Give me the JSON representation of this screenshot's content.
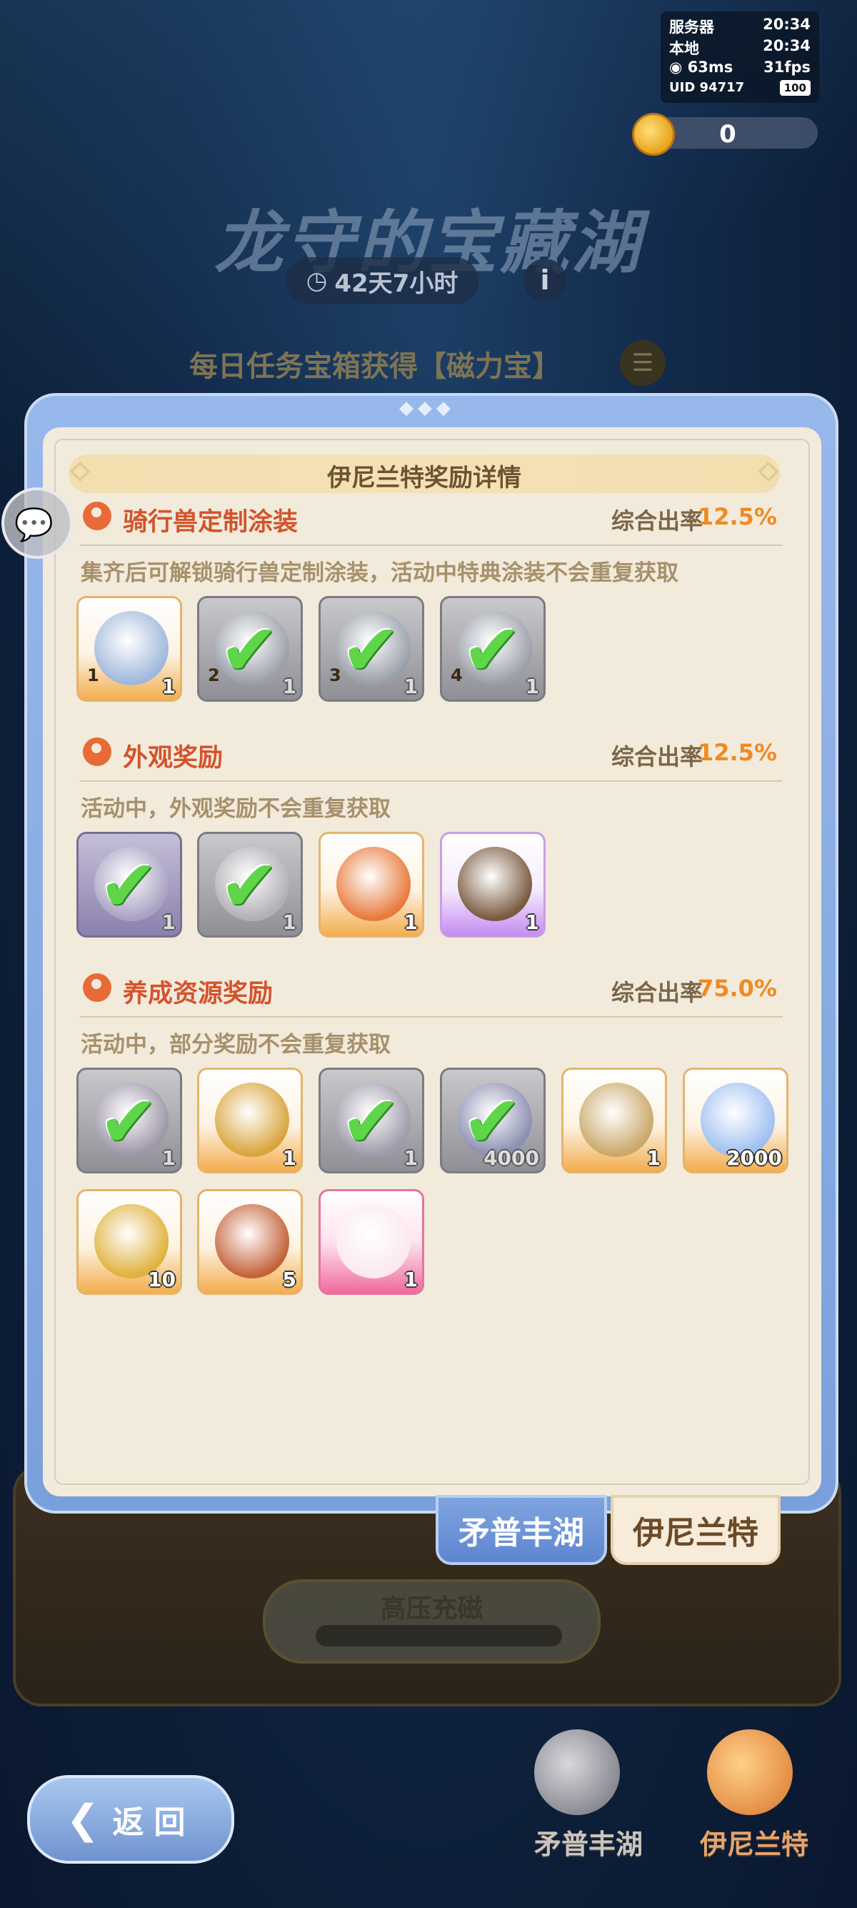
{
  "status": {
    "server_label": "服务器",
    "server_time": "20:34",
    "local_label": "本地",
    "local_time": "20:34",
    "ping": "63ms",
    "fps": "31fps",
    "uid_label": "UID",
    "uid": "94717",
    "battery": "100"
  },
  "currency": {
    "icon": "magnet-coin-icon",
    "value": "0"
  },
  "event": {
    "title": "龙守的宝藏湖",
    "timer": "42天7小时",
    "daily_text": "每日任务宝箱获得【磁力宝】"
  },
  "modal": {
    "title": "伊尼兰特奖励详情",
    "sections": [
      {
        "title": "骑行兽定制涂装",
        "rate_label": "综合出率",
        "rate": "12.5%",
        "desc": "集齐后可解锁骑行兽定制涂装，活动中特典涂装不会重复获取",
        "items": [
          {
            "style": "orange",
            "qty": "1",
            "badge": "1",
            "claimed": false,
            "art_color": "#9fb8dc"
          },
          {
            "style": "grey",
            "qty": "1",
            "badge": "2",
            "claimed": true,
            "art_color": "#9aa0aa"
          },
          {
            "style": "grey",
            "qty": "1",
            "badge": "3",
            "claimed": true,
            "art_color": "#9aa0aa"
          },
          {
            "style": "grey",
            "qty": "1",
            "badge": "4",
            "claimed": true,
            "art_color": "#9aa0aa"
          }
        ]
      },
      {
        "title": "外观奖励",
        "rate_label": "综合出率",
        "rate": "12.5%",
        "desc": "活动中，外观奖励不会重复获取",
        "items": [
          {
            "style": "greypurple",
            "qty": "1",
            "badge": "",
            "claimed": true,
            "art_color": "#a9a2c2"
          },
          {
            "style": "grey",
            "qty": "1",
            "badge": "",
            "claimed": true,
            "art_color": "#b0b0b6"
          },
          {
            "style": "orange",
            "qty": "1",
            "badge": "",
            "claimed": false,
            "art_color": "#e87a3c"
          },
          {
            "style": "purple",
            "qty": "1",
            "badge": "",
            "claimed": false,
            "art_color": "#7a5a40"
          }
        ]
      },
      {
        "title": "养成资源奖励",
        "rate_label": "综合出率",
        "rate": "75.0%",
        "desc": "活动中，部分奖励不会重复获取",
        "items": [
          {
            "style": "grey",
            "qty": "1",
            "badge": "",
            "claimed": true,
            "art_color": "#9d96a8"
          },
          {
            "style": "orange",
            "qty": "1",
            "badge": "",
            "claimed": false,
            "art_color": "#d9a43c"
          },
          {
            "style": "grey",
            "qty": "1",
            "badge": "",
            "claimed": true,
            "art_color": "#a09cab"
          },
          {
            "style": "grey",
            "qty": "4000",
            "badge": "",
            "claimed": true,
            "art_color": "#8b8fb0"
          },
          {
            "style": "orange",
            "qty": "1",
            "badge": "",
            "claimed": false,
            "art_color": "#c9a86a"
          },
          {
            "style": "orange",
            "qty": "2000",
            "badge": "",
            "claimed": false,
            "art_color": "#9fc0f2"
          },
          {
            "style": "orange",
            "qty": "10",
            "badge": "",
            "claimed": false,
            "art_color": "#e0b23c"
          },
          {
            "style": "orange",
            "qty": "5",
            "badge": "",
            "claimed": false,
            "art_color": "#c4623a"
          },
          {
            "style": "pink",
            "qty": "1",
            "badge": "",
            "claimed": false,
            "art_color": "#fbe9ee"
          }
        ]
      }
    ],
    "tabs": [
      "矛普丰湖",
      "伊尼兰特"
    ],
    "active_tab": "伊尼兰特"
  },
  "bottom": {
    "charge_label": "高压充磁",
    "back_label": "返回",
    "lake_left": "矛普丰湖",
    "lake_right": "伊尼兰特"
  },
  "colors": {
    "accent_orange": "#f08a23",
    "section_title": "#d4532b",
    "claimed_check": "#5fd64a"
  }
}
